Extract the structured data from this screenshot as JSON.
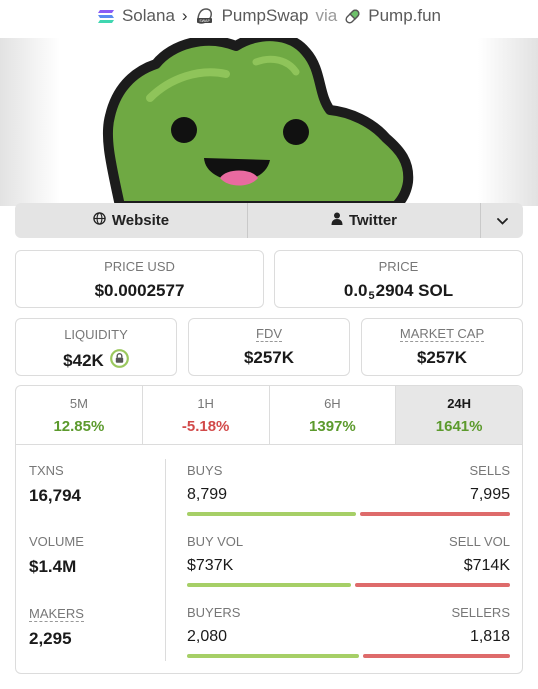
{
  "breadcrumb": {
    "chain": "Solana",
    "dex": "PumpSwap",
    "via": "via",
    "launchpad": "Pump.fun"
  },
  "links": {
    "website": "Website",
    "twitter": "Twitter"
  },
  "stats": {
    "price_usd_label": "PRICE USD",
    "price_usd": "$0.0002577",
    "price_label": "PRICE",
    "price_sol_prefix": "0.0",
    "price_sol_zeros": "5",
    "price_sol_suffix": "2904 SOL",
    "liquidity_label": "LIQUIDITY",
    "liquidity": "$42K",
    "fdv_label": "FDV",
    "fdv": "$257K",
    "mcap_label": "MARKET CAP",
    "mcap": "$257K"
  },
  "timeframes": [
    {
      "label": "5M",
      "change": "12.85%",
      "direction": "up"
    },
    {
      "label": "1H",
      "change": "-5.18%",
      "direction": "down"
    },
    {
      "label": "6H",
      "change": "1397%",
      "direction": "up"
    },
    {
      "label": "24H",
      "change": "1641%",
      "direction": "up",
      "selected": true
    }
  ],
  "activity": {
    "txns_label": "TXNS",
    "txns": "16,794",
    "buys_label": "BUYS",
    "buys": "8,799",
    "sells_label": "SELLS",
    "sells": "7,995",
    "buys_share": 0.524,
    "volume_label": "VOLUME",
    "volume": "$1.4M",
    "buy_vol_label": "BUY VOL",
    "buy_vol": "$737K",
    "sell_vol_label": "SELL VOL",
    "sell_vol": "$714K",
    "buy_vol_share": 0.508,
    "makers_label": "MAKERS",
    "makers": "2,295",
    "buyers_label": "BUYERS",
    "buyers": "2,080",
    "sellers_label": "SELLERS",
    "sellers": "1,818",
    "buyers_share": 0.534
  },
  "colors": {
    "positive": "#5c9a2d",
    "negative": "#d24a4a",
    "buy_bar": "#a6cf67",
    "sell_bar": "#de6b6b",
    "mascot": "#6fa943"
  },
  "icons": {
    "chain": "solana-icon",
    "dex": "pumpswap-icon",
    "launchpad": "pill-icon",
    "website": "globe-icon",
    "twitter": "user-icon",
    "more": "chevron-down-icon",
    "liquidity": "lock-icon"
  }
}
